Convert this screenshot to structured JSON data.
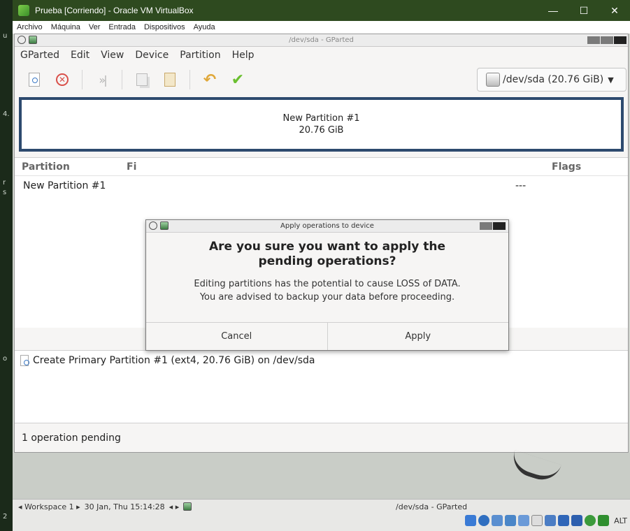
{
  "host": {
    "window_title": "Prueba [Corriendo] - Oracle VM VirtualBox",
    "menu": [
      "Archivo",
      "Máquina",
      "Ver",
      "Entrada",
      "Dispositivos",
      "Ayuda"
    ],
    "win_controls": [
      "—",
      "☐",
      "✕"
    ],
    "left_edge_glyphs": [
      "u",
      "4.",
      "r",
      "s",
      "o",
      "2"
    ]
  },
  "gparted": {
    "window_title": "/dev/sda - GParted",
    "menu": [
      "GParted",
      "Edit",
      "View",
      "Device",
      "Partition",
      "Help"
    ],
    "device_selector": "/dev/sda (20.76 GiB)",
    "disk_graph": {
      "name": "New Partition #1",
      "size": "20.76 GiB"
    },
    "columns": {
      "partition": "Partition",
      "flags": "Flags",
      "partial": "Fi"
    },
    "rows": [
      {
        "partition": "New Partition #1",
        "flags": "---"
      }
    ],
    "operations": [
      "Create Primary Partition #1 (ext4, 20.76 GiB) on /dev/sda"
    ],
    "status": "1 operation pending"
  },
  "dialog": {
    "title": "Apply operations to device",
    "heading": "Are you sure you want to apply the pending operations?",
    "body_line1": "Editing partitions has the potential to cause LOSS of DATA.",
    "body_line2": "You are advised to backup your data before proceeding.",
    "cancel_label": "Cancel",
    "apply_label": "Apply"
  },
  "guest_panel": {
    "workspace": "◂ Workspace 1 ▸",
    "clock": "30 Jan, Thu 15:14:28",
    "nav": "◂ ▸",
    "task": "/dev/sda - GParted",
    "alt_label": "ALT"
  },
  "colors": {
    "host_title_bg": "#2e4a1f",
    "disk_border": "#2d4a6e",
    "delete_red": "#d9504a",
    "apply_green": "#6abf2f"
  }
}
